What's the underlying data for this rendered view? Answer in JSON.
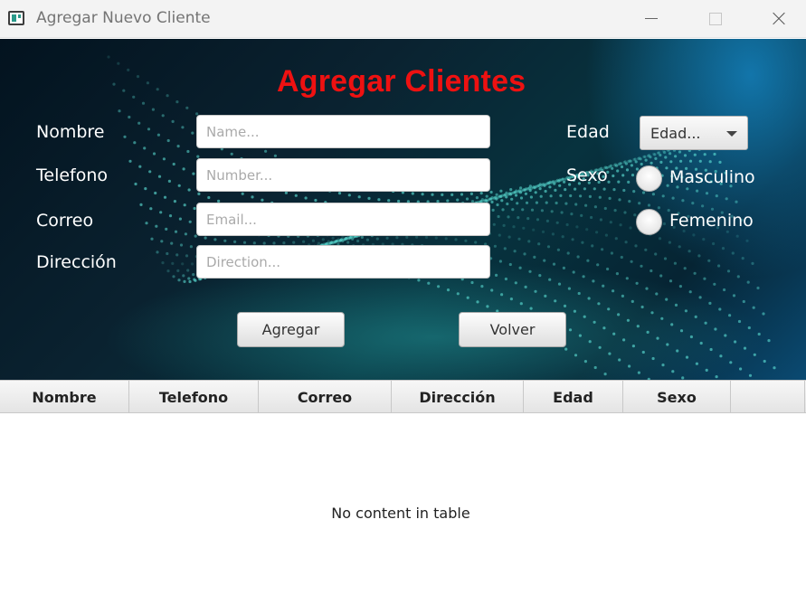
{
  "window": {
    "title": "Agregar Nuevo Cliente",
    "controls": [
      "minimize-icon",
      "maximize-icon",
      "close-icon"
    ]
  },
  "form": {
    "title": "Agregar Clientes",
    "title_color": "#ee1111",
    "fields": {
      "nombre": {
        "label": "Nombre",
        "placeholder": "Name...",
        "value": ""
      },
      "telefono": {
        "label": "Telefono",
        "placeholder": "Number...",
        "value": ""
      },
      "correo": {
        "label": "Correo",
        "placeholder": "Email...",
        "value": ""
      },
      "direccion": {
        "label": "Dirección",
        "placeholder": "Direction...",
        "value": ""
      }
    },
    "edad": {
      "label": "Edad",
      "selected": "Edad..."
    },
    "sexo": {
      "label": "Sexo",
      "options": [
        {
          "label": "Masculino",
          "checked": false
        },
        {
          "label": "Femenino",
          "checked": false
        }
      ]
    },
    "buttons": {
      "agregar": "Agregar",
      "volver": "Volver"
    }
  },
  "table": {
    "columns": [
      "Nombre",
      "Telefono",
      "Correo",
      "Dirección",
      "Edad",
      "Sexo"
    ],
    "rows": [],
    "empty_message": "No content in table"
  }
}
